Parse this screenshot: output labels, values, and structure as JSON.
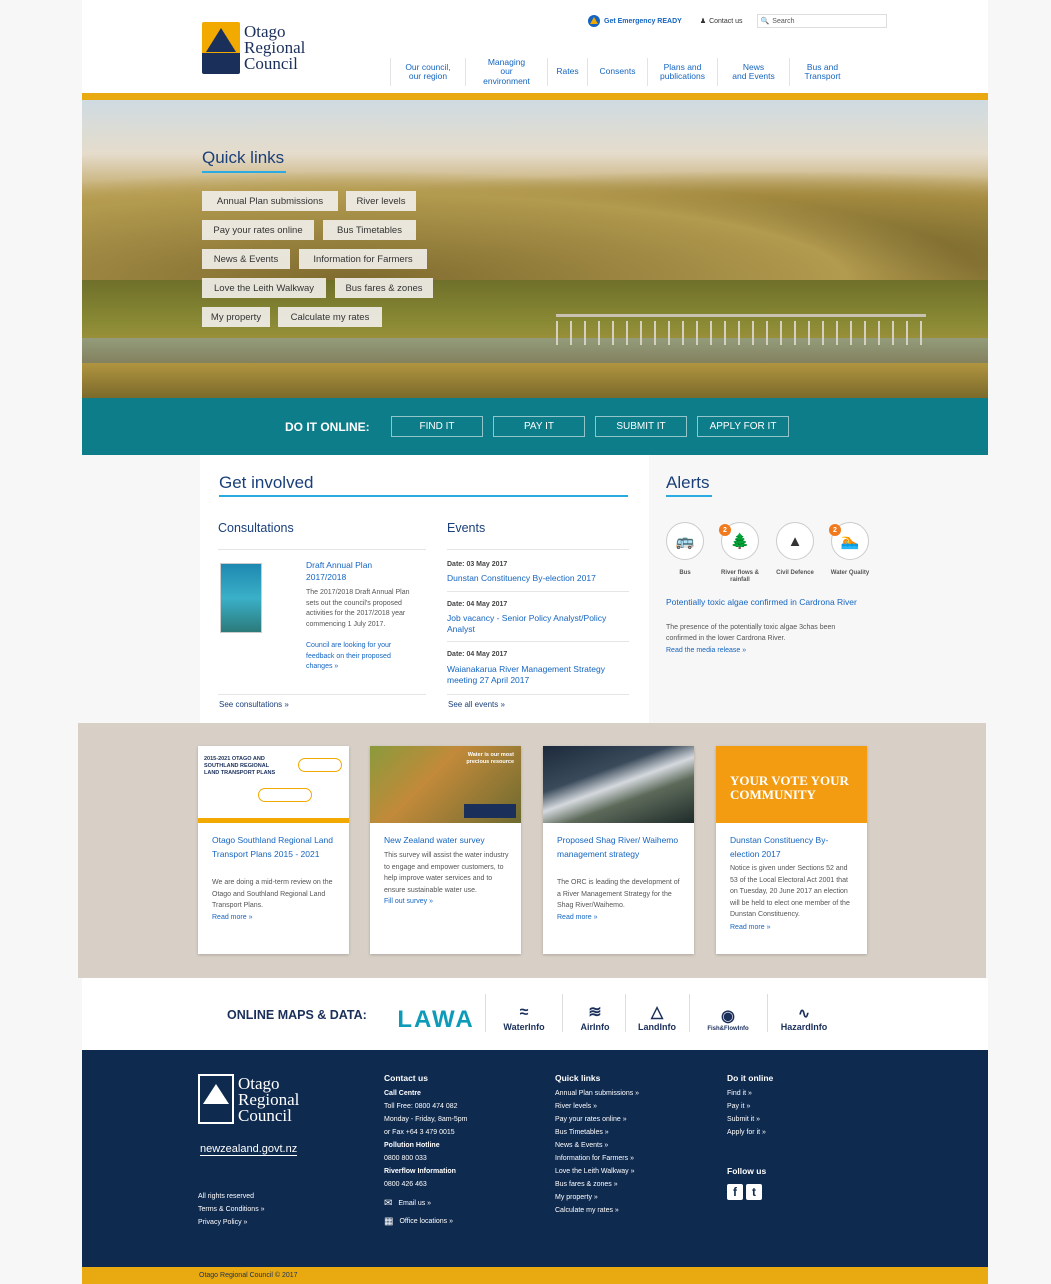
{
  "header": {
    "logo_lines": [
      "Otago",
      "Regional",
      "Council"
    ],
    "emergency": "Get Emergency READY",
    "contact": "Contact us",
    "search_placeholder": "Search",
    "nav": [
      {
        "line1": "Our council,",
        "line2": "our region"
      },
      {
        "line1": "Managing",
        "line2": "our environment"
      },
      {
        "line1": "Rates",
        "line2": ""
      },
      {
        "line1": "Consents",
        "line2": ""
      },
      {
        "line1": "Plans and",
        "line2": "publications"
      },
      {
        "line1": "News",
        "line2": "and Events"
      },
      {
        "line1": "Bus and",
        "line2": "Transport"
      }
    ]
  },
  "quick_links": {
    "title": "Quick links",
    "items": [
      "Annual Plan submissions",
      "River levels",
      "Pay your rates online",
      "Bus Timetables",
      "News & Events",
      "Information for Farmers",
      "Love the Leith Walkway",
      "Bus fares & zones",
      "My property",
      "Calculate my rates"
    ]
  },
  "do_it_online": {
    "label": "DO IT ONLINE:",
    "buttons": [
      "FIND IT",
      "PAY IT",
      "SUBMIT IT",
      "APPLY FOR IT"
    ]
  },
  "get_involved": {
    "title": "Get involved",
    "consultations": {
      "heading": "Consultations",
      "item_title": "Draft Annual Plan 2017/2018",
      "item_desc": "The 2017/2018 Draft Annual Plan sets out the council's proposed activities for the 2017/2018 year commencing 1 July 2017.",
      "item_link": "Council are looking for your feedback on their proposed changes »",
      "see_all": "See consultations »"
    },
    "events": {
      "heading": "Events",
      "items": [
        {
          "date": "Date: 03 May 2017",
          "title": "Dunstan Constituency By-election 2017"
        },
        {
          "date": "Date: 04 May 2017",
          "title": "Job vacancy - Senior Policy Analyst/Policy Analyst"
        },
        {
          "date": "Date: 04 May 2017",
          "title": "Waianakarua River Management Strategy meeting 27 April 2017"
        }
      ],
      "see_all": "See all events »"
    }
  },
  "alerts": {
    "title": "Alerts",
    "icons": [
      {
        "label": "Bus",
        "badge": ""
      },
      {
        "label": "River flows & rainfall",
        "badge": "2"
      },
      {
        "label": "Civil Defence",
        "badge": ""
      },
      {
        "label": "Water Quality",
        "badge": "2"
      }
    ],
    "headline": "Potentially toxic algae confirmed in Cardrona River",
    "body": "The presence of the potentially toxic algae 3chas been confirmed in the lower Cardrona River.",
    "link": "Read the media release »"
  },
  "cards": [
    {
      "title": "Otago Southland Regional Land Transport Plans 2015 - 2021",
      "desc": "We are doing a mid-term review on the Otago and Southland Regional Land Transport Plans.",
      "link": "Read more »",
      "img_text": "2015-2021 OTAGO AND SOUTHLAND REGIONAL LAND TRANSPORT PLANS"
    },
    {
      "title": "New Zealand water survey",
      "desc": "This survey will assist the water industry to engage and empower customers, to help improve water services and to ensure sustainable water use.",
      "link": "Fill out survey »",
      "img_text": "Water is our most precious resource"
    },
    {
      "title": "Proposed Shag River/ Waihemo management strategy",
      "desc": "The ORC is leading the development of a River Management Strategy for the Shag River/Waihemo.",
      "link": "Read more »",
      "img_text": ""
    },
    {
      "title": "Dunstan Constituency By-election 2017",
      "desc": "Notice is given under Sections 52 and 53 of the Local Electoral Act 2001 that on Tuesday, 20 June 2017 an election will be held to elect one member of the Dunstan Constituency.",
      "link": "Read more »",
      "img_text": "YOUR VOTE YOUR COMMUNITY"
    }
  ],
  "maps": {
    "label": "ONLINE MAPS & DATA:",
    "logos": [
      "LAWA",
      "WaterInfo",
      "AirInfo",
      "LandInfo",
      "Fish&FlowInfo",
      "HazardInfo"
    ]
  },
  "footer": {
    "logo_lines": [
      "Otago",
      "Regional",
      "Council"
    ],
    "govt": "newzealand.govt.nz",
    "rights": "All rights reserved",
    "terms": "Terms & Conditions »",
    "privacy": "Privacy Policy »",
    "contact_heading": "Contact us",
    "call_centre": "Call Centre",
    "toll_free": "Toll Free: 0800 474 082",
    "hours": "Monday - Friday, 8am-5pm",
    "fax": "or Fax +64 3 479 0015",
    "pollution": "Pollution Hotline",
    "pollution_num": "0800 800 033",
    "riverflow": "Riverflow Information",
    "riverflow_num": "0800 426 463",
    "email": "Email us »",
    "offices": "Office locations »",
    "quick_heading": "Quick links",
    "quick_links": [
      "Annual Plan submissions »",
      "River levels »",
      "Pay your rates online »",
      "Bus Timetables »",
      "News & Events »",
      "Information for Farmers »",
      "Love the Leith Walkway »",
      "Bus fares & zones »",
      "My property »",
      "Calculate my rates »"
    ],
    "online_heading": "Do it online",
    "online_links": [
      "Find it »",
      "Pay it »",
      "Submit it »",
      "Apply for it »"
    ],
    "follow": "Follow us",
    "copyright": "Otago Regional Council © 2017"
  },
  "colors": {
    "navy": "#0f2a4f",
    "gold": "#e8aa10",
    "teal": "#0e7d8a",
    "link": "#1565c0",
    "accent_line": "#29abe2"
  }
}
